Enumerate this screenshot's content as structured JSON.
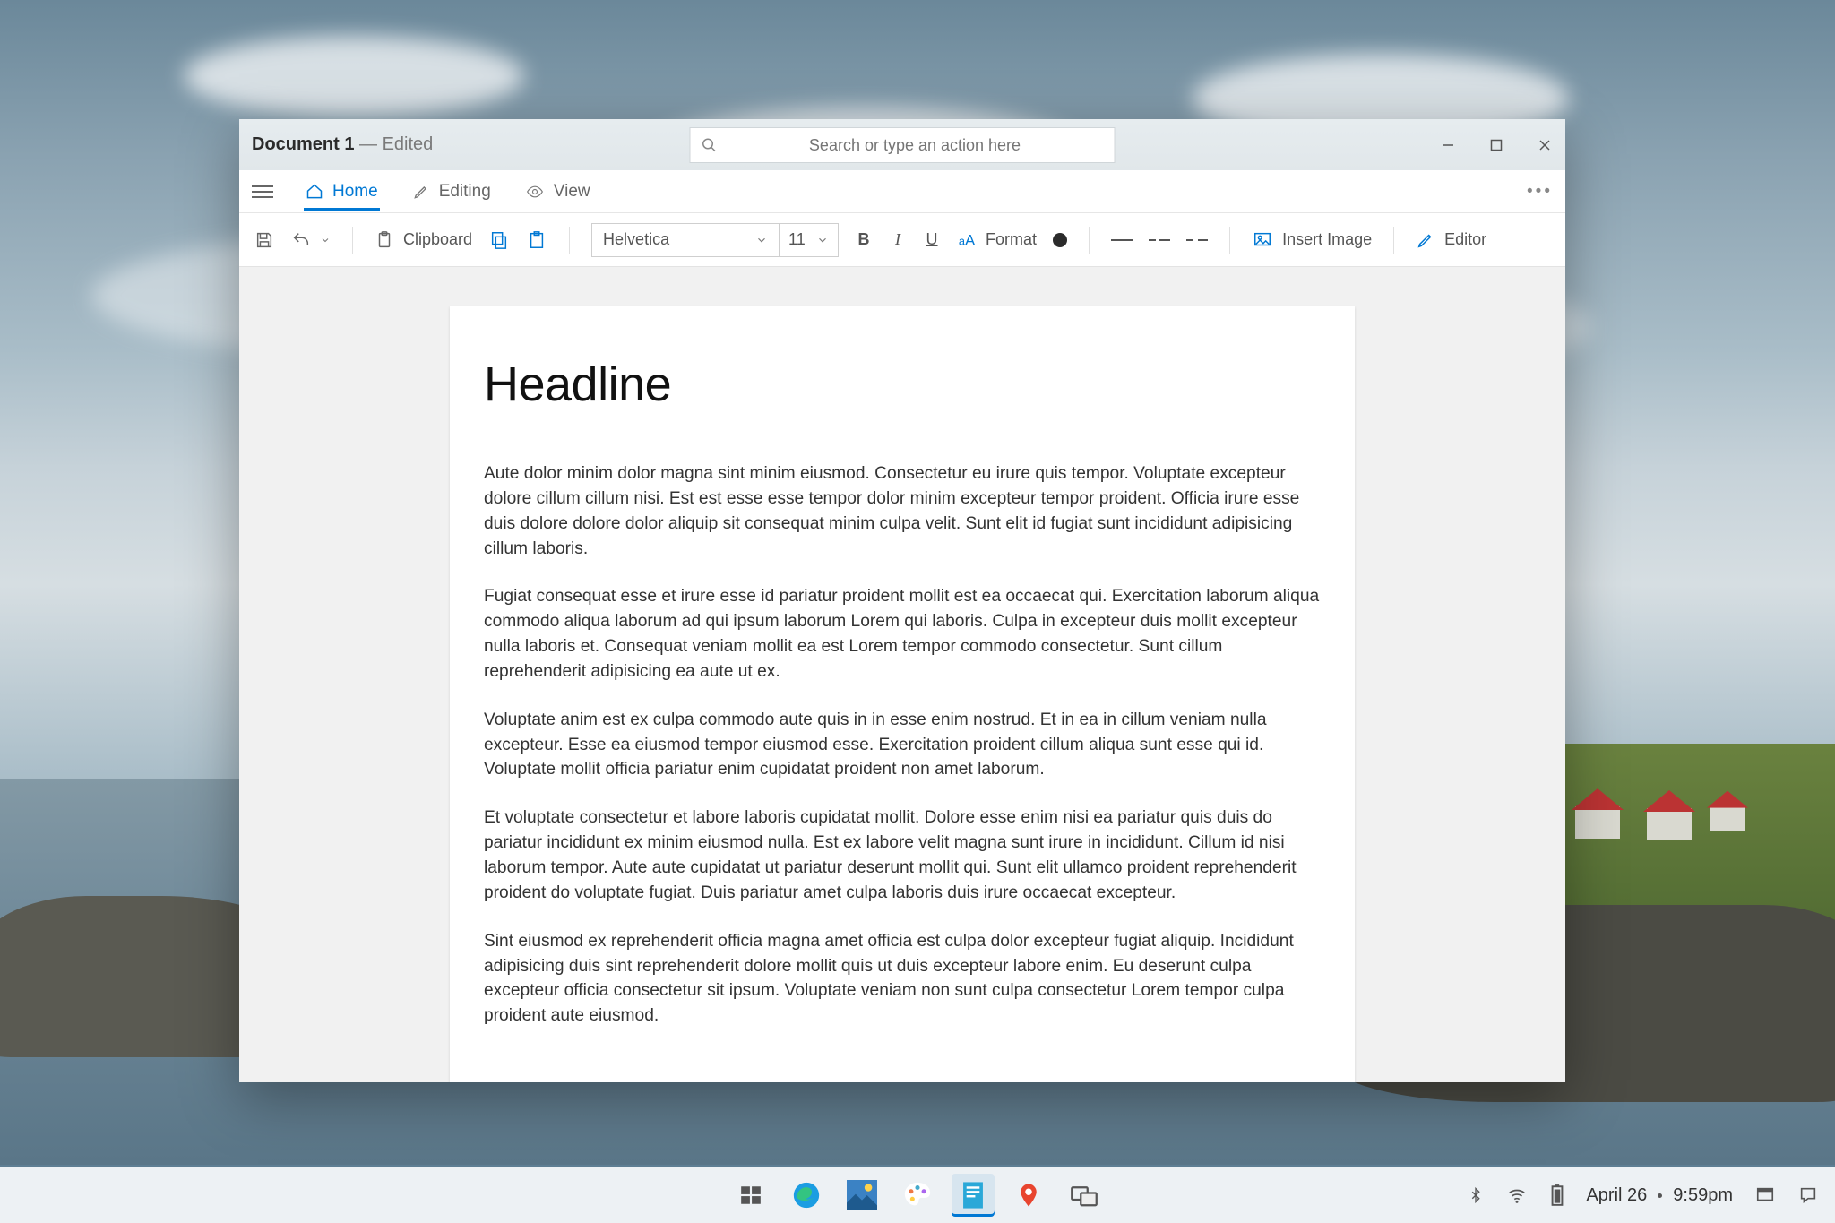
{
  "window": {
    "title_main": "Document 1",
    "title_suffix": " — Edited",
    "search_placeholder": "Search or type an action here"
  },
  "tabs": {
    "home": {
      "label": "Home"
    },
    "editing": {
      "label": "Editing"
    },
    "view": {
      "label": "View"
    }
  },
  "toolbar": {
    "clipboard_label": "Clipboard",
    "font_name": "Helvetica",
    "font_size": "11",
    "bold": "B",
    "italic": "I",
    "underline": "U",
    "format_label": "Format",
    "insert_image_label": "Insert Image",
    "editor_label": "Editor",
    "font_color": "#2b2b2b"
  },
  "document": {
    "headline": "Headline",
    "paragraphs": [
      "Aute dolor minim dolor magna sint minim eiusmod. Consectetur eu irure quis tempor. Voluptate excepteur dolore cillum cillum nisi. Est est esse esse tempor dolor minim excepteur tempor proident. Officia irure esse duis dolore dolore dolor aliquip sit consequat minim culpa velit. Sunt elit id fugiat sunt incididunt adipisicing cillum laboris.",
      "Fugiat consequat esse et irure esse id pariatur proident mollit est ea occaecat qui. Exercitation laborum aliqua commodo aliqua laborum ad qui ipsum laborum Lorem qui laboris. Culpa in excepteur duis mollit excepteur nulla laboris et. Consequat veniam mollit ea est Lorem tempor commodo consectetur. Sunt cillum reprehenderit adipisicing ea aute ut ex.",
      "Voluptate anim est ex culpa commodo aute quis in in esse enim nostrud. Et in ea in cillum veniam nulla excepteur. Esse ea eiusmod tempor eiusmod esse. Exercitation proident cillum aliqua sunt esse qui id. Voluptate mollit officia pariatur enim cupidatat proident non amet laborum.",
      "Et voluptate consectetur et labore laboris cupidatat mollit. Dolore esse enim nisi ea pariatur quis duis do pariatur incididunt ex minim eiusmod nulla. Est ex labore velit magna sunt irure in incididunt. Cillum id nisi laborum tempor. Aute aute cupidatat ut pariatur deserunt mollit qui. Sunt elit ullamco proident reprehenderit proident do voluptate fugiat. Duis pariatur amet culpa laboris duis irure occaecat excepteur.",
      "Sint eiusmod ex reprehenderit officia magna amet officia est culpa dolor excepteur fugiat aliquip. Incididunt adipisicing duis sint reprehenderit dolore mollit quis ut duis excepteur labore enim. Eu deserunt culpa excepteur officia consectetur sit ipsum. Voluptate veniam non sunt culpa consectetur Lorem tempor culpa proident aute eiusmod."
    ]
  },
  "taskbar": {
    "date": "April 26",
    "time": "9:59pm"
  }
}
